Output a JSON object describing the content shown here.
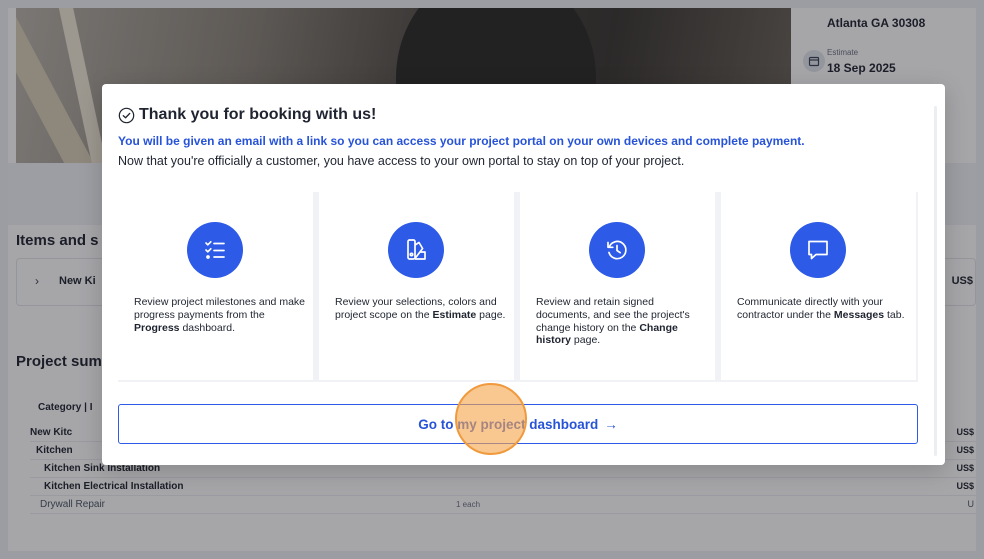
{
  "background": {
    "address": "Atlanta GA 30308",
    "estimate_label": "Estimate",
    "estimate_date": "18 Sep 2025",
    "items_section_title": "Items and s",
    "items_row_label": "New Ki",
    "items_row_amount": "US$",
    "summary_title": "Project sum",
    "summary_header": "Category | I",
    "summary_rows": [
      {
        "label": "New Kitc",
        "amount": "US$",
        "mid": ""
      },
      {
        "label": "Kitchen",
        "amount": "US$",
        "mid": ""
      },
      {
        "label": "Kitchen Sink Installation",
        "amount": "US$",
        "mid": ""
      },
      {
        "label": "Kitchen Electrical Installation",
        "amount": "US$",
        "mid": ""
      },
      {
        "label": "Drywall Repair",
        "amount": "U",
        "mid": "1 each"
      }
    ]
  },
  "modal": {
    "title": "Thank you for booking with us!",
    "highlight": "You will be given an email with a link so you can access your project portal on your own devices and complete payment.",
    "subtitle": "Now that you're officially a customer, you have access to your own portal to stay on top of your project.",
    "cards": [
      {
        "icon": "checklist-icon",
        "pre": "Review project milestones and make progress payments from the ",
        "bold": "Progress",
        "post": " dashboard."
      },
      {
        "icon": "swatches-icon",
        "pre": "Review your selections, colors and project scope on the ",
        "bold": "Estimate",
        "post": " page."
      },
      {
        "icon": "history-icon",
        "pre": "Review and retain signed documents, and see the project's change history on the ",
        "bold": "Change history",
        "post": " page."
      },
      {
        "icon": "chat-icon",
        "pre": "Communicate directly with your contractor under the ",
        "bold": "Messages",
        "post": " tab."
      }
    ],
    "cta_label": "Go to my project dashboard",
    "cta_arrow": "→"
  },
  "colors": {
    "accent": "#2d5ae6",
    "link": "#2753d8",
    "click_marker": "#f6a44c"
  }
}
